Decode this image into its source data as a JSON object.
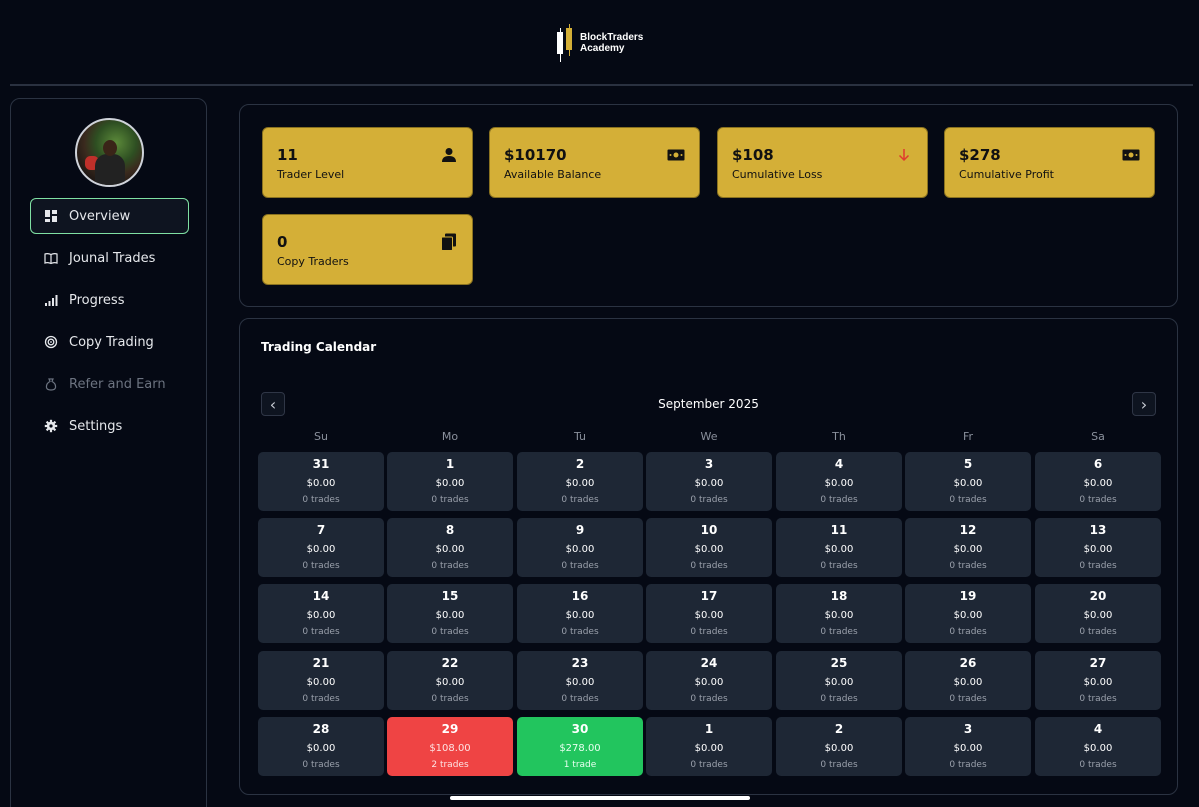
{
  "brand": {
    "line1": "BlockTraders",
    "line2": "Academy"
  },
  "sidebar": {
    "items": [
      {
        "label": "Overview",
        "icon": "dashboard-icon"
      },
      {
        "label": "Jounal Trades",
        "icon": "book-icon"
      },
      {
        "label": "Progress",
        "icon": "bar-chart-icon"
      },
      {
        "label": "Copy Trading",
        "icon": "target-icon"
      },
      {
        "label": "Refer and Earn",
        "icon": "money-bag-icon"
      },
      {
        "label": "Settings",
        "icon": "gear-icon"
      }
    ]
  },
  "stats": [
    {
      "value": "11",
      "label": "Trader Level",
      "icon": "user-icon"
    },
    {
      "value": "$10170",
      "label": "Available Balance",
      "icon": "banknote-icon"
    },
    {
      "value": "$108",
      "label": "Cumulative Loss",
      "icon": "arrow-down-icon"
    },
    {
      "value": "$278",
      "label": "Cumulative Profit",
      "icon": "banknote-icon"
    },
    {
      "value": "0",
      "label": "Copy Traders",
      "icon": "copy-icon"
    }
  ],
  "colors": {
    "accent": "#d4af37",
    "loss": "#ef4444",
    "profit": "#22c55e",
    "active_border": "#7fe0a3"
  },
  "calendar": {
    "title": "Trading Calendar",
    "month": "September 2025",
    "weekdays": [
      "Su",
      "Mo",
      "Tu",
      "We",
      "Th",
      "Fr",
      "Sa"
    ],
    "days": [
      {
        "num": "31",
        "amt": "$0.00",
        "trades": "0 trades",
        "status": "none"
      },
      {
        "num": "1",
        "amt": "$0.00",
        "trades": "0 trades",
        "status": "none"
      },
      {
        "num": "2",
        "amt": "$0.00",
        "trades": "0 trades",
        "status": "none"
      },
      {
        "num": "3",
        "amt": "$0.00",
        "trades": "0 trades",
        "status": "none"
      },
      {
        "num": "4",
        "amt": "$0.00",
        "trades": "0 trades",
        "status": "none"
      },
      {
        "num": "5",
        "amt": "$0.00",
        "trades": "0 trades",
        "status": "none"
      },
      {
        "num": "6",
        "amt": "$0.00",
        "trades": "0 trades",
        "status": "none"
      },
      {
        "num": "7",
        "amt": "$0.00",
        "trades": "0 trades",
        "status": "none"
      },
      {
        "num": "8",
        "amt": "$0.00",
        "trades": "0 trades",
        "status": "none"
      },
      {
        "num": "9",
        "amt": "$0.00",
        "trades": "0 trades",
        "status": "none"
      },
      {
        "num": "10",
        "amt": "$0.00",
        "trades": "0 trades",
        "status": "none"
      },
      {
        "num": "11",
        "amt": "$0.00",
        "trades": "0 trades",
        "status": "none"
      },
      {
        "num": "12",
        "amt": "$0.00",
        "trades": "0 trades",
        "status": "none"
      },
      {
        "num": "13",
        "amt": "$0.00",
        "trades": "0 trades",
        "status": "none"
      },
      {
        "num": "14",
        "amt": "$0.00",
        "trades": "0 trades",
        "status": "none"
      },
      {
        "num": "15",
        "amt": "$0.00",
        "trades": "0 trades",
        "status": "none"
      },
      {
        "num": "16",
        "amt": "$0.00",
        "trades": "0 trades",
        "status": "none"
      },
      {
        "num": "17",
        "amt": "$0.00",
        "trades": "0 trades",
        "status": "none"
      },
      {
        "num": "18",
        "amt": "$0.00",
        "trades": "0 trades",
        "status": "none"
      },
      {
        "num": "19",
        "amt": "$0.00",
        "trades": "0 trades",
        "status": "none"
      },
      {
        "num": "20",
        "amt": "$0.00",
        "trades": "0 trades",
        "status": "none"
      },
      {
        "num": "21",
        "amt": "$0.00",
        "trades": "0 trades",
        "status": "none"
      },
      {
        "num": "22",
        "amt": "$0.00",
        "trades": "0 trades",
        "status": "none"
      },
      {
        "num": "23",
        "amt": "$0.00",
        "trades": "0 trades",
        "status": "none"
      },
      {
        "num": "24",
        "amt": "$0.00",
        "trades": "0 trades",
        "status": "none"
      },
      {
        "num": "25",
        "amt": "$0.00",
        "trades": "0 trades",
        "status": "none"
      },
      {
        "num": "26",
        "amt": "$0.00",
        "trades": "0 trades",
        "status": "none"
      },
      {
        "num": "27",
        "amt": "$0.00",
        "trades": "0 trades",
        "status": "none"
      },
      {
        "num": "28",
        "amt": "$0.00",
        "trades": "0 trades",
        "status": "none"
      },
      {
        "num": "29",
        "amt": "$108.00",
        "trades": "2 trades",
        "status": "loss"
      },
      {
        "num": "30",
        "amt": "$278.00",
        "trades": "1 trade",
        "status": "win"
      },
      {
        "num": "1",
        "amt": "$0.00",
        "trades": "0 trades",
        "status": "none"
      },
      {
        "num": "2",
        "amt": "$0.00",
        "trades": "0 trades",
        "status": "none"
      },
      {
        "num": "3",
        "amt": "$0.00",
        "trades": "0 trades",
        "status": "none"
      },
      {
        "num": "4",
        "amt": "$0.00",
        "trades": "0 trades",
        "status": "none"
      }
    ]
  }
}
